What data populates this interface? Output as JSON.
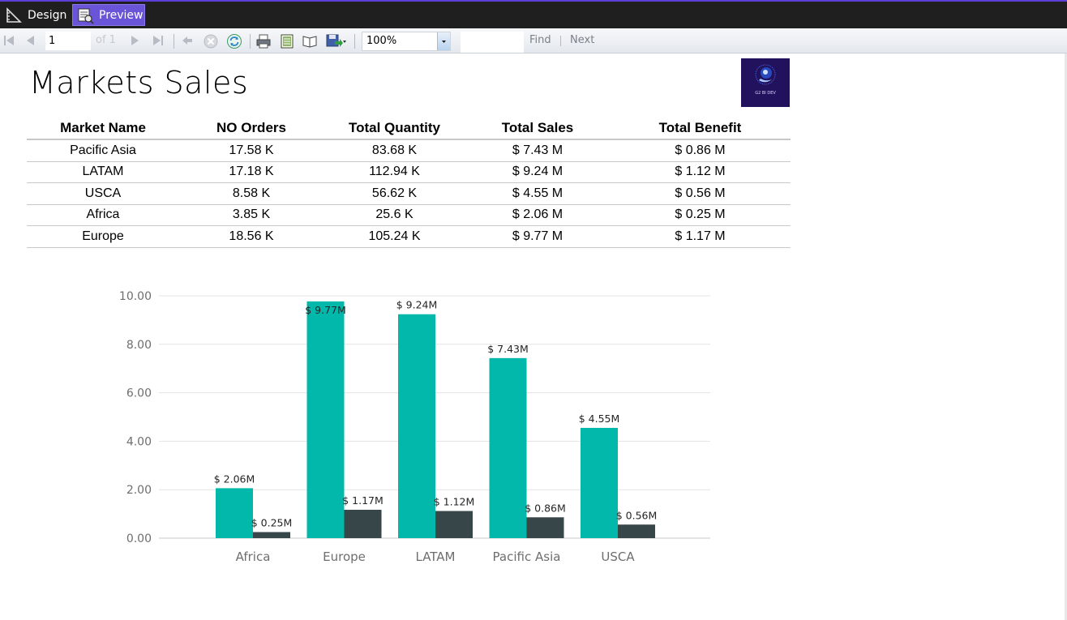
{
  "tabs": {
    "design": "Design",
    "preview": "Preview"
  },
  "toolbar": {
    "page_current": "1",
    "page_of": "of 1",
    "zoom": "100%",
    "find_text": "",
    "find_label": "Find",
    "next_label": "Next"
  },
  "report": {
    "title": "Markets Sales",
    "logo_text": "G2 BI DEV",
    "table": {
      "headers": [
        "Market Name",
        "NO Orders",
        "Total Quantity",
        "Total Sales",
        "Total Benefit"
      ],
      "rows": [
        [
          "Pacific Asia",
          "17.58 K",
          "83.68 K",
          "$ 7.43 M",
          "$ 0.86 M"
        ],
        [
          "LATAM",
          "17.18 K",
          "112.94 K",
          "$ 9.24 M",
          "$ 1.12 M"
        ],
        [
          "USCA",
          "8.58 K",
          "56.62 K",
          "$ 4.55 M",
          "$ 0.56 M"
        ],
        [
          "Africa",
          "3.85 K",
          "25.6 K",
          "$ 2.06 M",
          "$ 0.25 M"
        ],
        [
          "Europe",
          "18.56 K",
          "105.24 K",
          "$ 9.77 M",
          "$ 1.17 M"
        ]
      ]
    }
  },
  "chart_data": {
    "type": "bar",
    "categories": [
      "Africa",
      "Europe",
      "LATAM",
      "Pacific Asia",
      "USCA"
    ],
    "series": [
      {
        "values": [
          2.06,
          9.77,
          9.24,
          7.43,
          4.55
        ],
        "labels": [
          "$ 2.06M",
          "$ 9.77M",
          "$ 9.24M",
          "$ 7.43M",
          "$ 4.55M"
        ],
        "color": "#01b8aa"
      },
      {
        "values": [
          0.25,
          1.17,
          1.12,
          0.86,
          0.56
        ],
        "labels": [
          "$ 0.25M",
          "$ 1.17M",
          "$ 1.12M",
          "$ 0.86M",
          "$ 0.56M"
        ],
        "color": "#374649"
      }
    ],
    "yticks": [
      "0.00",
      "2.00",
      "4.00",
      "6.00",
      "8.00",
      "10.00"
    ],
    "ylim": [
      0,
      10
    ],
    "grid": true,
    "legend": "none"
  }
}
